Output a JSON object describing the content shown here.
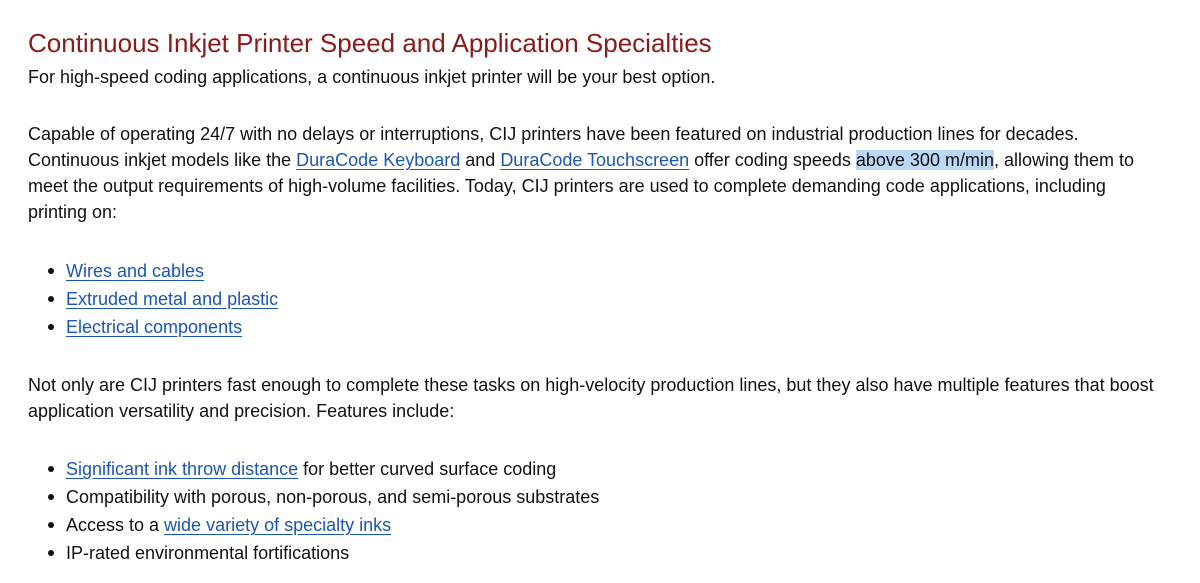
{
  "heading": "Continuous Inkjet Printer Speed and Application Specialties",
  "lead": "For high-speed coding applications, a continuous inkjet printer will be your best option.",
  "para1": {
    "t1": "Capable of operating 24/7 with no delays or interruptions, CIJ printers have been featured on industrial production lines for decades. Continuous inkjet models like the ",
    "link1": "DuraCode Keyboard",
    "t2": " and ",
    "link2": "DuraCode Touchscreen",
    "t3": " offer coding speeds ",
    "highlight": "above 300 m/min",
    "t4": ", allowing them to meet the output requirements of high-volume facilities. Today, CIJ printers are used to complete demanding code applications, including printing on:"
  },
  "list1": [
    "Wires and cables ",
    "Extruded metal and plastic",
    "Electrical components"
  ],
  "para2": "Not only are CIJ printers fast enough to complete these tasks on high-velocity production lines, but they also have multiple features that boost application versatility and precision. Features include:",
  "list2": {
    "item1_link": "Significant ink throw distance",
    "item1_text": " for better curved surface coding",
    "item2_text": "Compatibility with porous, non-porous, and semi-porous substrates",
    "item3_text": "Access to a ",
    "item3_link": "wide variety of specialty inks",
    "item4_text": "IP-rated environmental fortifications"
  },
  "colors": {
    "heading": "#8b1a1a",
    "link": "#1a55b8",
    "selection_highlight": "#bcd6f5",
    "text": "#111111"
  }
}
